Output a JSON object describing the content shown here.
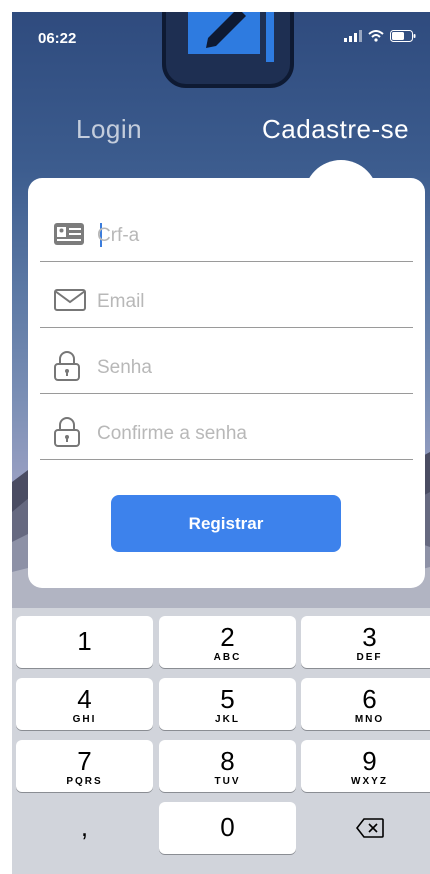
{
  "status_bar": {
    "time": "06:22"
  },
  "tabs": {
    "login": "Login",
    "signup": "Cadastre-se"
  },
  "form": {
    "fields": [
      {
        "placeholder": "Crf-a",
        "icon": "id-card-icon"
      },
      {
        "placeholder": "Email",
        "icon": "envelope-icon"
      },
      {
        "placeholder": "Senha",
        "icon": "lock-icon"
      },
      {
        "placeholder": "Confirme a senha",
        "icon": "lock-icon"
      }
    ],
    "submit_label": "Registrar"
  },
  "keyboard": {
    "keys": [
      {
        "digit": "1",
        "letters": ""
      },
      {
        "digit": "2",
        "letters": "ABC"
      },
      {
        "digit": "3",
        "letters": "DEF"
      },
      {
        "digit": "4",
        "letters": "GHI"
      },
      {
        "digit": "5",
        "letters": "JKL"
      },
      {
        "digit": "6",
        "letters": "MNO"
      },
      {
        "digit": "7",
        "letters": "PQRS"
      },
      {
        "digit": "8",
        "letters": "TUV"
      },
      {
        "digit": "9",
        "letters": "WXYZ"
      },
      {
        "digit": ",",
        "letters": ""
      },
      {
        "digit": "0",
        "letters": ""
      }
    ],
    "delete_icon": "backspace-icon"
  },
  "colors": {
    "accent": "#3d82ec",
    "card": "#ffffff",
    "keyboard_bg": "#d1d4db"
  }
}
